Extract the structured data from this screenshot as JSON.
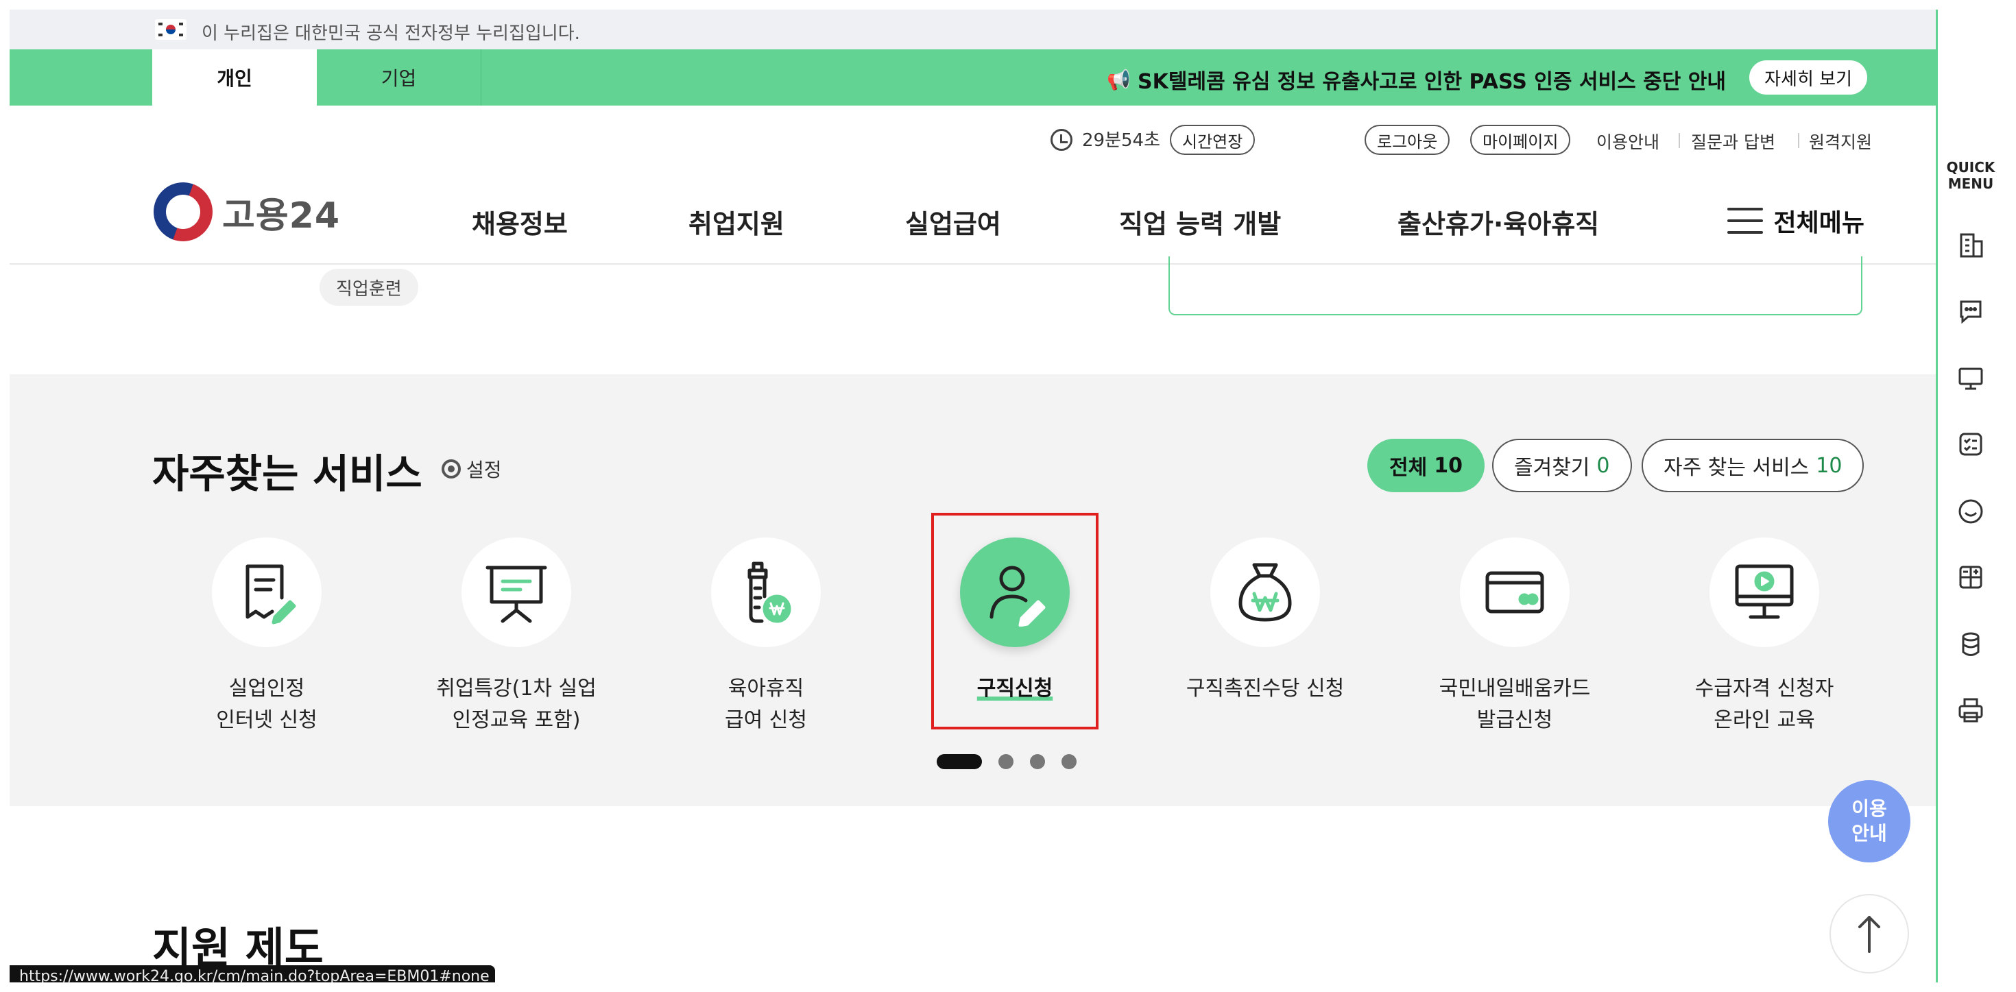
{
  "gov_banner": {
    "text": "이 누리집은 대한민국 공식 전자정부 누리집입니다."
  },
  "top_tabs": {
    "personal": "개인",
    "company": "기업"
  },
  "notice": {
    "text": "SK텔레콤 유심 정보 유출사고로 인한 PASS 인증 서비스 중단 안내",
    "button": "자세히 보기"
  },
  "utility": {
    "timer": "29분54초",
    "extend": "시간연장",
    "logout": "로그아웃",
    "mypage": "마이페이지",
    "links": [
      "이용안내",
      "질문과 답변",
      "원격지원"
    ]
  },
  "logo": {
    "name": "고용24"
  },
  "nav": {
    "items": [
      "채용정보",
      "취업지원",
      "실업급여",
      "직업 능력 개발",
      "출산휴가·육아휴직"
    ],
    "all_menu": "전체메뉴"
  },
  "partial": {
    "tag": "직업훈련"
  },
  "services": {
    "title": "자주찾는 서비스",
    "setting": "설정",
    "filters": [
      {
        "label": "전체",
        "count": "10"
      },
      {
        "label": "즐겨찾기",
        "count": "0"
      },
      {
        "label": "자주 찾는 서비스",
        "count": "10"
      }
    ],
    "items": [
      {
        "label": "실업인정\n인터넷 신청",
        "icon": "document-edit-icon"
      },
      {
        "label": "취업특강(1차 실업\n인정교육 포함)",
        "icon": "presentation-board-icon"
      },
      {
        "label": "육아휴직\n급여 신청",
        "icon": "baby-bottle-won-icon"
      },
      {
        "label": "구직신청",
        "icon": "person-edit-icon",
        "selected": true
      },
      {
        "label": "구직촉진수당 신청",
        "icon": "money-bag-icon"
      },
      {
        "label": "국민내일배움카드\n발급신청",
        "icon": "card-icon"
      },
      {
        "label": "수급자격 신청자\n온라인 교육",
        "icon": "monitor-play-icon"
      }
    ],
    "page_total": 4,
    "page_current": 1
  },
  "support": {
    "title": "지원 제도"
  },
  "status_url": "https://www.work24.go.kr/cm/main.do?topArea=EBM01#none",
  "quick_menu": {
    "title": "QUICK\nMENU"
  },
  "floating": {
    "guide": "이용\n안내"
  },
  "colors": {
    "accent": "#63d394",
    "guide": "#7e9ef2",
    "highlight": "#e0201e"
  }
}
